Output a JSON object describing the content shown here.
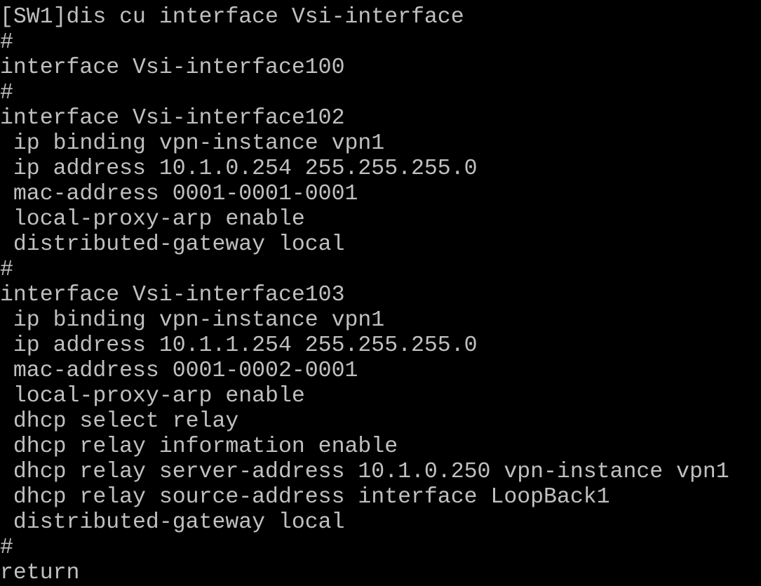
{
  "terminal": {
    "text_color": "#c0c0c0",
    "background_color": "#000000",
    "lines": [
      "[SW1]dis cu interface Vsi-interface",
      "#",
      "interface Vsi-interface100",
      "#",
      "interface Vsi-interface102",
      " ip binding vpn-instance vpn1",
      " ip address 10.1.0.254 255.255.255.0",
      " mac-address 0001-0001-0001",
      " local-proxy-arp enable",
      " distributed-gateway local",
      "#",
      "interface Vsi-interface103",
      " ip binding vpn-instance vpn1",
      " ip address 10.1.1.254 255.255.255.0",
      " mac-address 0001-0002-0001",
      " local-proxy-arp enable",
      " dhcp select relay",
      " dhcp relay information enable",
      " dhcp relay server-address 10.1.0.250 vpn-instance vpn1",
      " dhcp relay source-address interface LoopBack1",
      " distributed-gateway local",
      "#",
      "return"
    ]
  }
}
